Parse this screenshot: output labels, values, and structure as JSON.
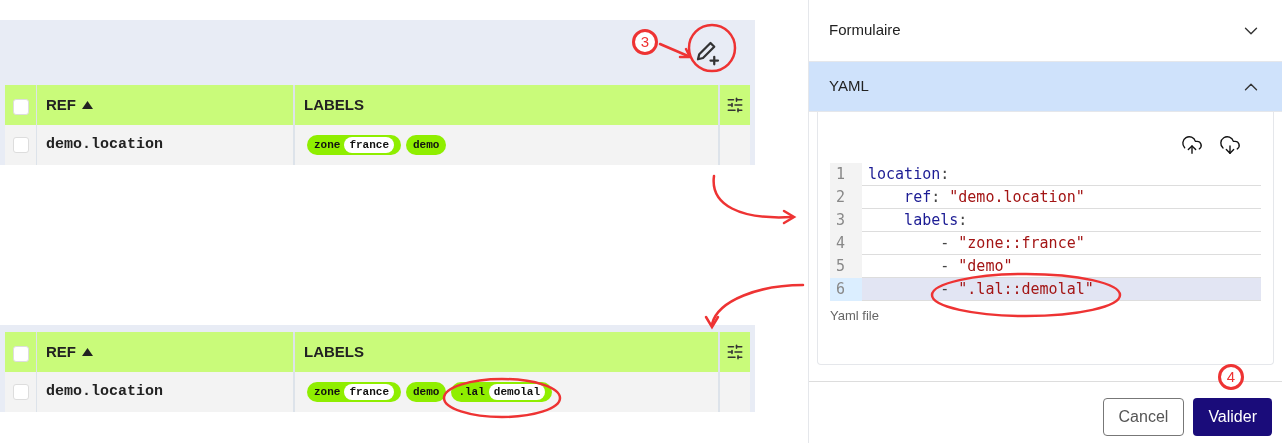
{
  "tables": [
    {
      "toolbar": true,
      "columns": [
        "REF",
        "LABELS"
      ],
      "header_checked": false,
      "rows": [
        {
          "selected": false,
          "ref": "demo.location",
          "labels": [
            {
              "key": "zone",
              "value": "france"
            },
            {
              "key": "demo"
            }
          ]
        }
      ]
    },
    {
      "toolbar": false,
      "columns": [
        "REF",
        "LABELS"
      ],
      "header_checked": false,
      "rows": [
        {
          "selected": false,
          "ref": "demo.location",
          "labels": [
            {
              "key": "zone",
              "value": "france"
            },
            {
              "key": "demo"
            },
            {
              "key": ".lal",
              "value": "demolal"
            }
          ]
        }
      ]
    }
  ],
  "panel": {
    "sections": [
      {
        "title": "Formulaire",
        "expanded": false
      },
      {
        "title": "YAML",
        "expanded": true
      }
    ],
    "editor": {
      "lines": [
        {
          "number": "1",
          "selected": false,
          "segments": [
            {
              "kind": "key",
              "text": "location"
            },
            {
              "kind": "punct",
              "text": ":"
            }
          ]
        },
        {
          "number": "2",
          "selected": false,
          "segments": [
            {
              "kind": "key",
              "text": "    ref"
            },
            {
              "kind": "punct",
              "text": ": "
            },
            {
              "kind": "string",
              "text": "\"demo.location\""
            }
          ]
        },
        {
          "number": "3",
          "selected": false,
          "segments": [
            {
              "kind": "key",
              "text": "    labels"
            },
            {
              "kind": "punct",
              "text": ":"
            }
          ]
        },
        {
          "number": "4",
          "selected": false,
          "segments": [
            {
              "kind": "punct",
              "text": "        - "
            },
            {
              "kind": "string",
              "text": "\"zone::france\""
            }
          ]
        },
        {
          "number": "5",
          "selected": false,
          "segments": [
            {
              "kind": "punct",
              "text": "        - "
            },
            {
              "kind": "string",
              "text": "\"demo\""
            }
          ]
        },
        {
          "number": "6",
          "selected": true,
          "segments": [
            {
              "kind": "punct",
              "text": "        - "
            },
            {
              "kind": "string",
              "text": "\".lal::demolal\""
            }
          ]
        }
      ],
      "caption": "Yaml file"
    },
    "buttons": [
      {
        "kind": "secondary",
        "label": "Cancel"
      },
      {
        "kind": "primary",
        "label": "Valider"
      }
    ]
  },
  "annotations": [
    {
      "kind": "step",
      "text": "3"
    },
    {
      "kind": "step",
      "text": "4"
    }
  ]
}
